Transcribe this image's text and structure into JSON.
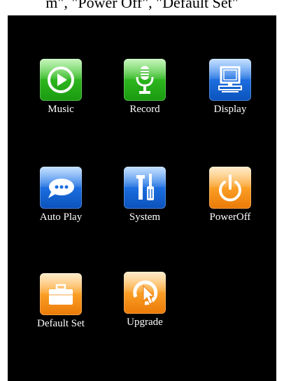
{
  "caption": "m\", \"Power Off\", \"Default Set\"",
  "apps": [
    {
      "label": "Music",
      "icon": "play-icon",
      "color": "green"
    },
    {
      "label": "Record",
      "icon": "microphone-icon",
      "color": "green"
    },
    {
      "label": "Display",
      "icon": "monitor-icon",
      "color": "blue"
    },
    {
      "label": "Auto Play",
      "icon": "speech-bubble-icon",
      "color": "blue"
    },
    {
      "label": "System",
      "icon": "tools-icon",
      "color": "blue"
    },
    {
      "label": "PowerOff",
      "icon": "power-icon",
      "color": "orange"
    },
    {
      "label": "Default Set",
      "icon": "briefcase-icon",
      "color": "orange"
    },
    {
      "label": "Upgrade",
      "icon": "clock-arrow-icon",
      "color": "orange"
    }
  ]
}
